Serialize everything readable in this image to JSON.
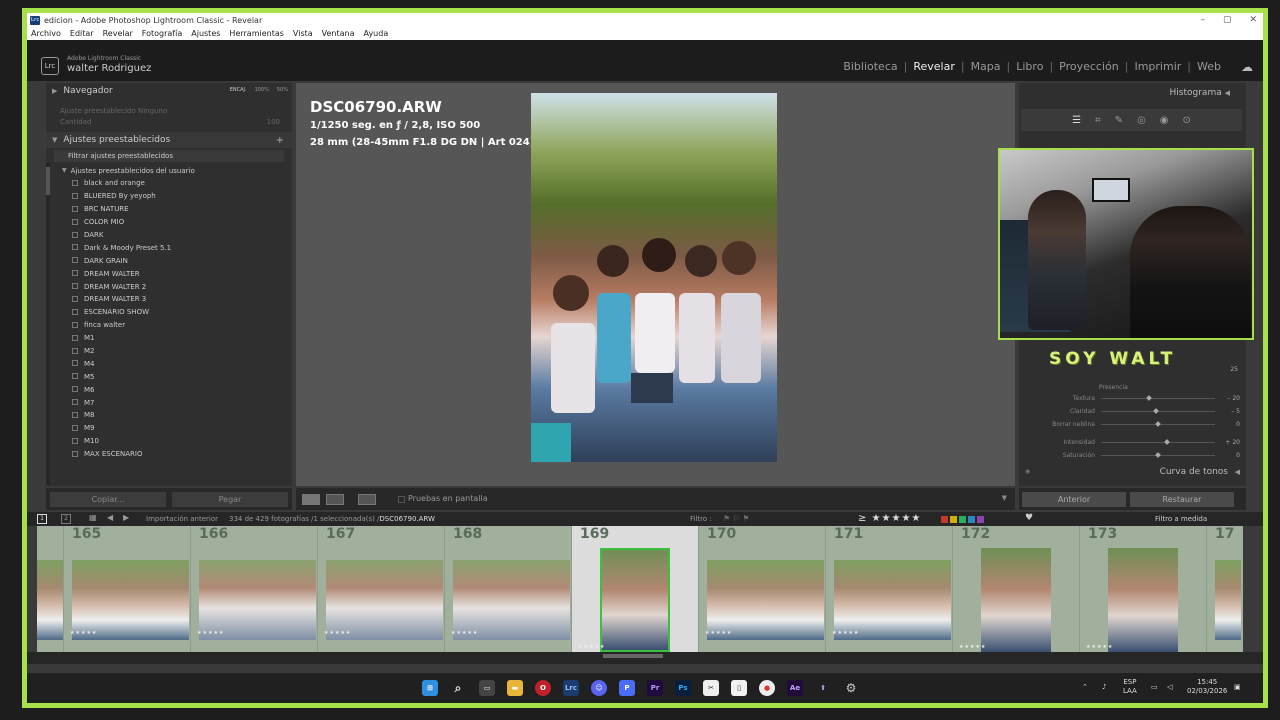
{
  "window": {
    "title": "edicion - Adobe Photoshop Lightroom Classic - Revelar",
    "controls": [
      "–",
      "▢",
      "✕"
    ]
  },
  "menu": [
    "Archivo",
    "Editar",
    "Revelar",
    "Fotografía",
    "Ajustes",
    "Herramientas",
    "Vista",
    "Ventana",
    "Ayuda"
  ],
  "brand": {
    "logo": "Lrc",
    "app": "Adobe Lightroom Classic",
    "user": "walter Rodriguez"
  },
  "modules": [
    "Biblioteca",
    "Revelar",
    "Mapa",
    "Libro",
    "Proyección",
    "Imprimir",
    "Web"
  ],
  "active_module": "Revelar",
  "left": {
    "navigator": "Navegador",
    "zoom": [
      "ENCAJ.",
      "100%",
      "50%"
    ],
    "preset_dim_1": "Ajuste preestablecido   Ninguno",
    "preset_dim_2": "Cantidad",
    "preset_dim_3": "100",
    "presets_header": "Ajustes preestablecidos",
    "filter": "Filtrar ajustes preestablecidos",
    "group": "Ajustes preestablecidos del usuario",
    "items": [
      "black and orange",
      "BLUERED By yeyoph",
      "BRC NATURE",
      "COLOR MIO",
      "DARK",
      "Dark & Moody Preset 5.1",
      "DARK GRAIN",
      "DREAM WALTER",
      "DREAM WALTER 2",
      "DREAM WALTER 3",
      "ESCENARIO SHOW",
      "finca walter",
      "M1",
      "M2",
      "M4",
      "M5",
      "M6",
      "M7",
      "M8",
      "M9",
      "M10",
      "MAX ESCENARIO"
    ],
    "copy": "Copiar...",
    "paste": "Pegar"
  },
  "photo": {
    "name": "DSC06790.ARW",
    "exposure": "1/1250 seg. en ƒ / 2,8, ISO 500",
    "lens": "28 mm (28-45mm F1.8 DG DN | Art 024)"
  },
  "center_toolbar": {
    "proofing": "Pruebas en pantalla"
  },
  "right": {
    "histogram": "Histograma",
    "presence": "Presencia",
    "sliders": [
      {
        "label": "Textura",
        "value": "– 20",
        "pos": 0.42
      },
      {
        "label": "Claridad",
        "value": "– 5",
        "pos": 0.48
      },
      {
        "label": "Borrar neblina",
        "value": "0",
        "pos": 0.5
      },
      {
        "label": "Intensidad",
        "value": "+ 20",
        "pos": 0.58
      },
      {
        "label": "Saturación",
        "value": "0",
        "pos": 0.5
      }
    ],
    "slider_extra_value": "25",
    "tone_curve": "Curva de tonos",
    "previous": "Anterior",
    "reset": "Restaurar"
  },
  "overlay": {
    "caption": "SOY WALT"
  },
  "filmstrip_bar": {
    "pages": [
      "1",
      "2"
    ],
    "source": "Importación anterior",
    "count": "334 de 429 fotografías /1 seleccionada(s) /",
    "file": "DSC06790.ARW",
    "filter_label": "Filtro :",
    "rating": "≥ ★★★★★",
    "fit": "Filtro a medida"
  },
  "filmstrip": {
    "selected_index": 5,
    "cells": [
      {
        "num": "",
        "type": "partial"
      },
      {
        "num": "165",
        "type": "crowd"
      },
      {
        "num": "166",
        "type": "group"
      },
      {
        "num": "167",
        "type": "group"
      },
      {
        "num": "168",
        "type": "group"
      },
      {
        "num": "169",
        "type": "vert"
      },
      {
        "num": "170",
        "type": "crowd"
      },
      {
        "num": "171",
        "type": "crowd"
      },
      {
        "num": "172",
        "type": "vert"
      },
      {
        "num": "173",
        "type": "vert"
      },
      {
        "num": "17",
        "type": "partial"
      }
    ],
    "stars": "★★★★★"
  },
  "taskbar": {
    "lang1": "ESP",
    "lang2": "LAA",
    "time": "15:45",
    "date": "02/03/2026"
  },
  "colors": {
    "accent_green": "#a6e04a",
    "filmstrip_bg": "#a0b09d",
    "swatches": [
      "#c0392b",
      "#d4ac0d",
      "#27ae60",
      "#2e86c1",
      "#8e44ad"
    ]
  }
}
